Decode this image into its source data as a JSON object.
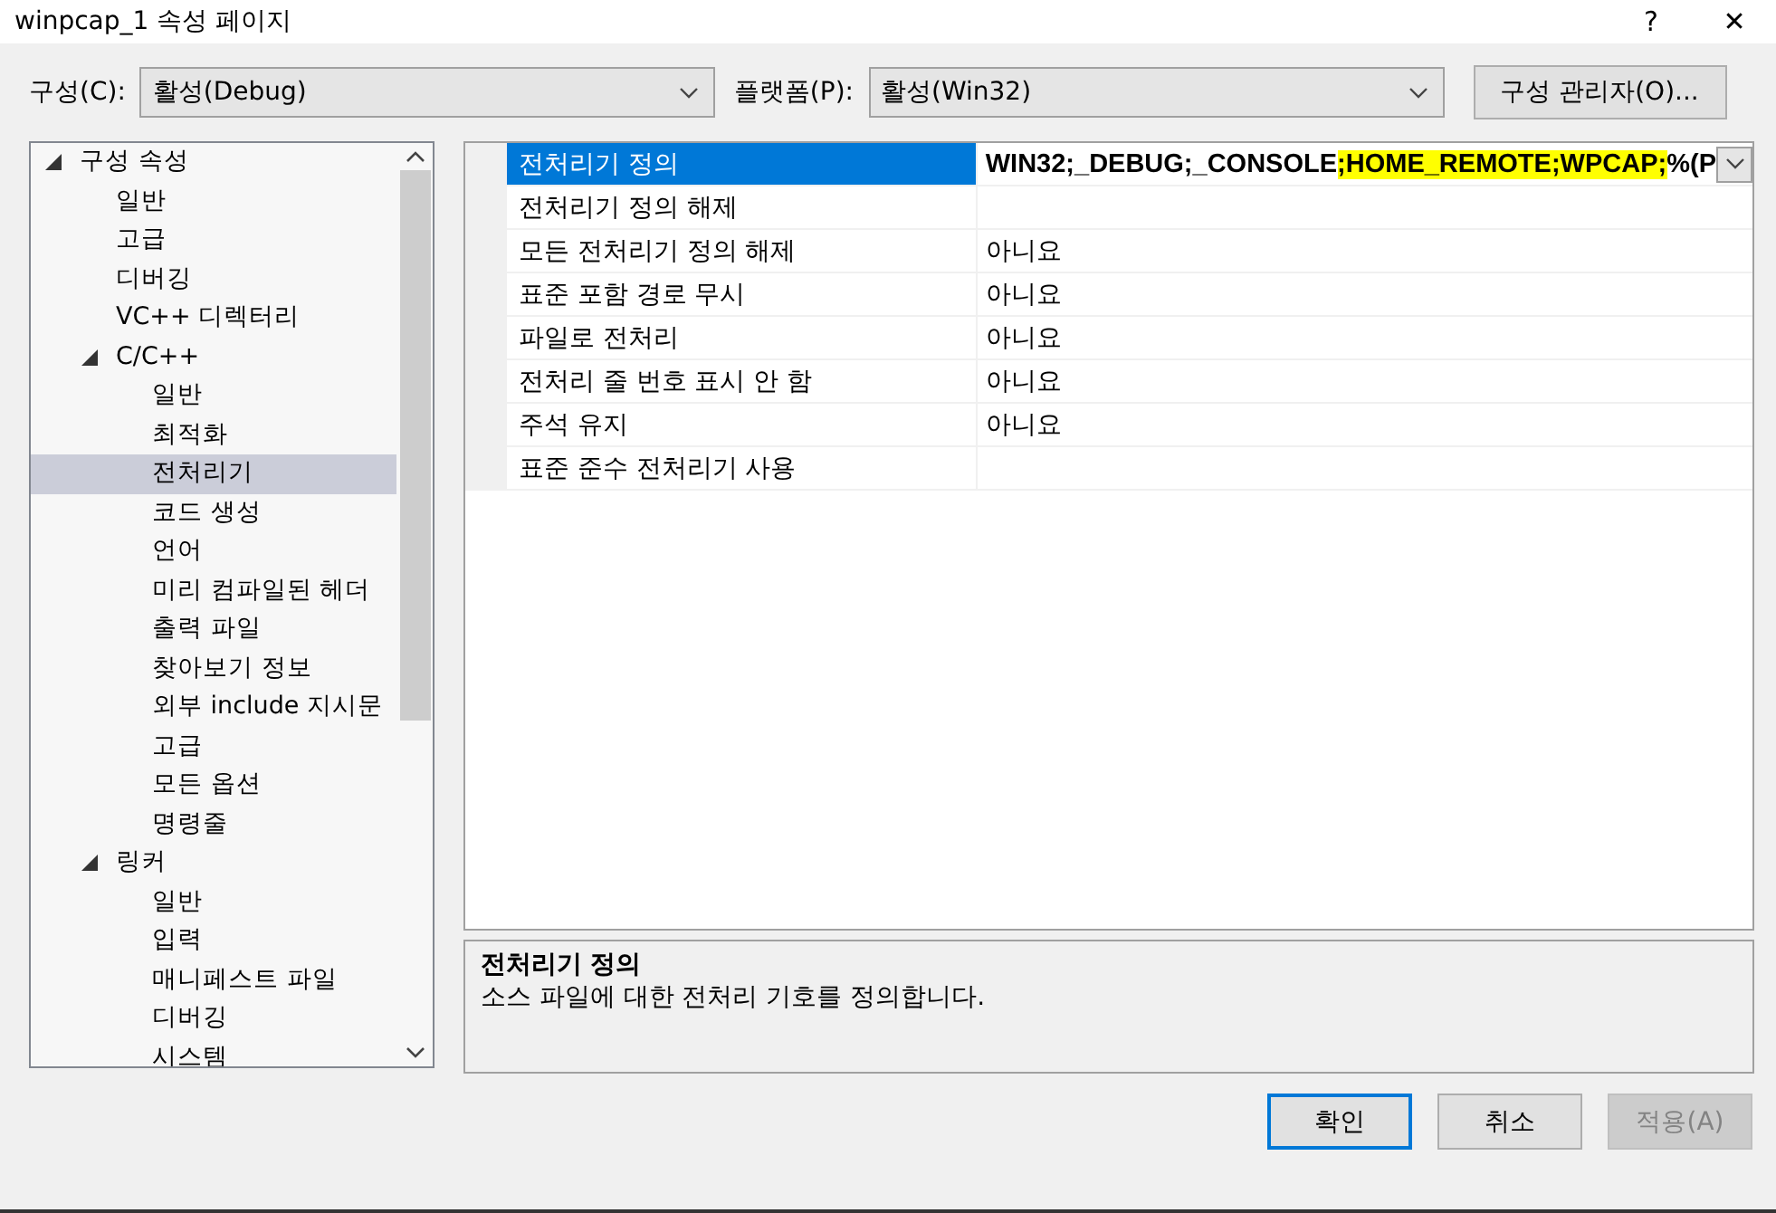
{
  "window": {
    "title": "winpcap_1 속성 페이지",
    "help": "?",
    "close": "✕"
  },
  "toolbar": {
    "configuration": {
      "label": "구성(C):",
      "value": "활성(Debug)"
    },
    "platform": {
      "label": "플랫폼(P):",
      "value": "활성(Win32)"
    },
    "manager_button": "구성 관리자(O)..."
  },
  "tree": [
    {
      "label": "구성 속성",
      "expanded": true,
      "selected": false,
      "children": [
        {
          "label": "일반",
          "selected": false
        },
        {
          "label": "고급",
          "selected": false
        },
        {
          "label": "디버깅",
          "selected": false
        },
        {
          "label": "VC++ 디렉터리",
          "selected": false
        },
        {
          "label": "C/C++",
          "expanded": true,
          "selected": false,
          "children": [
            {
              "label": "일반",
              "selected": false
            },
            {
              "label": "최적화",
              "selected": false
            },
            {
              "label": "전처리기",
              "selected": true
            },
            {
              "label": "코드 생성",
              "selected": false
            },
            {
              "label": "언어",
              "selected": false
            },
            {
              "label": "미리 컴파일된 헤더",
              "selected": false
            },
            {
              "label": "출력 파일",
              "selected": false
            },
            {
              "label": "찾아보기 정보",
              "selected": false
            },
            {
              "label": "외부 include 지시문",
              "selected": false
            },
            {
              "label": "고급",
              "selected": false
            },
            {
              "label": "모든 옵션",
              "selected": false
            },
            {
              "label": "명령줄",
              "selected": false
            }
          ]
        },
        {
          "label": "링커",
          "expanded": true,
          "selected": false,
          "children": [
            {
              "label": "일반",
              "selected": false
            },
            {
              "label": "입력",
              "selected": false
            },
            {
              "label": "매니페스트 파일",
              "selected": false
            },
            {
              "label": "디버깅",
              "selected": false
            },
            {
              "label": "시스템",
              "selected": false
            }
          ]
        }
      ]
    }
  ],
  "properties": [
    {
      "name": "전처리기 정의",
      "selected": true,
      "value": [
        {
          "text": "WIN32;_DEBUG;_CONSOLE",
          "highlighted": false
        },
        {
          "text": ";HOME_REMOTE;WPCAP;",
          "highlighted": true
        },
        {
          "text": "%(P",
          "highlighted": false
        }
      ]
    },
    {
      "name": "전처리기 정의 해제",
      "selected": false
    },
    {
      "name": "모든 전처리기 정의 해제",
      "selected": false,
      "value": [
        {
          "text": "아니요",
          "highlighted": false
        }
      ]
    },
    {
      "name": "표준 포함 경로 무시",
      "selected": false,
      "value": [
        {
          "text": "아니요",
          "highlighted": false
        }
      ]
    },
    {
      "name": "파일로 전처리",
      "selected": false,
      "value": [
        {
          "text": "아니요",
          "highlighted": false
        }
      ]
    },
    {
      "name": "전처리 줄 번호 표시 안 함",
      "selected": false,
      "value": [
        {
          "text": "아니요",
          "highlighted": false
        }
      ]
    },
    {
      "name": "주석 유지",
      "selected": false,
      "value": [
        {
          "text": "아니요",
          "highlighted": false
        }
      ]
    },
    {
      "name": "표준 준수 전처리기 사용",
      "selected": false
    }
  ],
  "description": {
    "title": "전처리기 정의",
    "text": "소스 파일에 대한 전처리 기호를 정의합니다."
  },
  "buttons": [
    {
      "label": "확인",
      "default": true,
      "disabled": false
    },
    {
      "label": "취소",
      "default": false,
      "disabled": false
    },
    {
      "label": "적용(A)",
      "default": false,
      "disabled": true
    }
  ]
}
